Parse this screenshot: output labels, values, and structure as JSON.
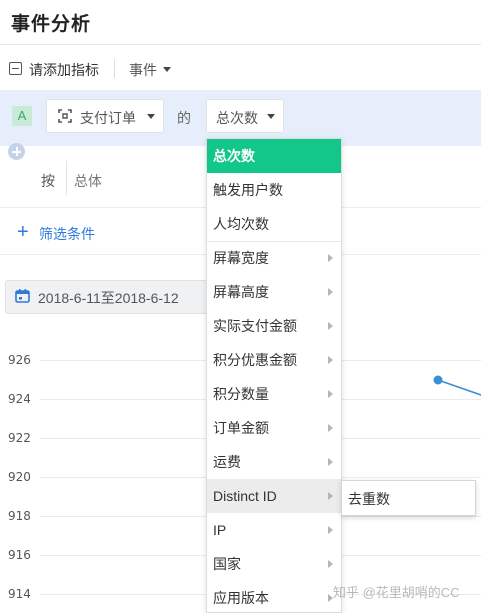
{
  "header": {
    "title": "事件分析"
  },
  "toolbar": {
    "add_metric_label": "请添加指标",
    "events_label": "事件"
  },
  "metric_row": {
    "badge": "A",
    "event_select": "支付订单",
    "connector": "的",
    "metric_select": "总次数"
  },
  "group_row": {
    "by_label": "按",
    "group_value": "总体"
  },
  "filter": {
    "label": "筛选条件"
  },
  "date_range": {
    "text": "2018-6-11至2018-6-12"
  },
  "chart_data": {
    "type": "line",
    "y_ticks": [
      "926",
      "924",
      "922",
      "920",
      "918",
      "916",
      "914"
    ],
    "series": [
      {
        "values": []
      }
    ]
  },
  "dropdown": {
    "items": [
      {
        "label": "总次数",
        "active": true,
        "has_sub": false
      },
      {
        "label": "触发用户数",
        "has_sub": false
      },
      {
        "label": "人均次数",
        "has_sub": false
      },
      {
        "label": "屏幕宽度",
        "has_sub": true
      },
      {
        "label": "屏幕高度",
        "has_sub": true
      },
      {
        "label": "实际支付金额",
        "has_sub": true
      },
      {
        "label": "积分优惠金额",
        "has_sub": true
      },
      {
        "label": "积分数量",
        "has_sub": true
      },
      {
        "label": "订单金额",
        "has_sub": true
      },
      {
        "label": "运费",
        "has_sub": true
      },
      {
        "label": "Distinct ID",
        "has_sub": true,
        "hover": true
      },
      {
        "label": "IP",
        "has_sub": true
      },
      {
        "label": "国家",
        "has_sub": true
      },
      {
        "label": "应用版本",
        "has_sub": true
      }
    ],
    "submenu": {
      "label": "去重数"
    }
  },
  "watermark": "知乎 @花里胡哨的CC",
  "colors": {
    "accent": "#13c68a",
    "link": "#2f7ad8",
    "band": "#e5eefa",
    "series": "#3a8fd6"
  }
}
